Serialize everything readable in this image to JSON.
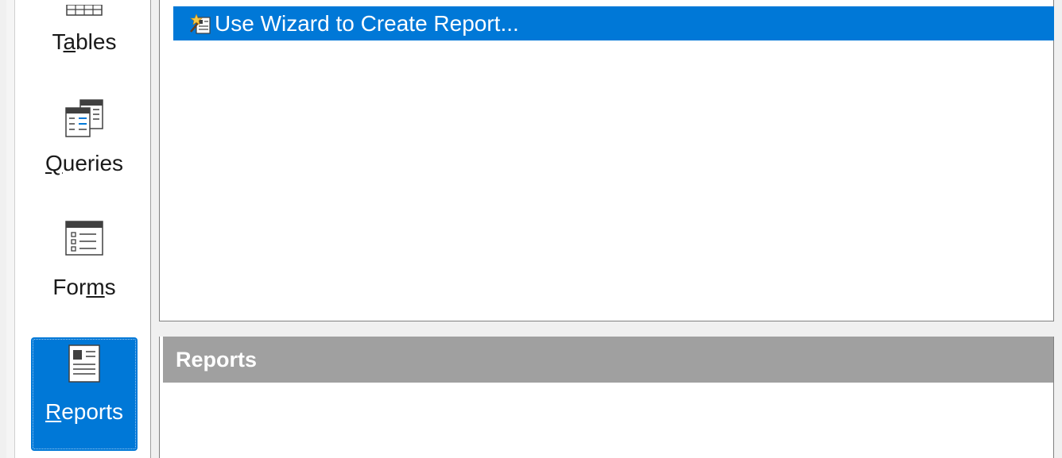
{
  "sidebar": {
    "items": [
      {
        "label_pre": "T",
        "label_accel": "a",
        "label_post": "bles",
        "icon": "table-icon"
      },
      {
        "label_pre": "",
        "label_accel": "Q",
        "label_post": "ueries",
        "icon": "query-icon"
      },
      {
        "label_pre": "For",
        "label_accel": "m",
        "label_post": "s",
        "icon": "form-icon"
      },
      {
        "label_pre": "",
        "label_accel": "R",
        "label_post": "eports",
        "icon": "report-icon",
        "selected": true
      }
    ]
  },
  "tasks": {
    "items": [
      {
        "label": "Use Wizard to Create Report...",
        "icon": "wizard-icon",
        "selected": true
      }
    ]
  },
  "reports": {
    "header": "Reports",
    "items": []
  },
  "colors": {
    "selection": "#0078d7",
    "header_bg": "#a0a0a0"
  }
}
